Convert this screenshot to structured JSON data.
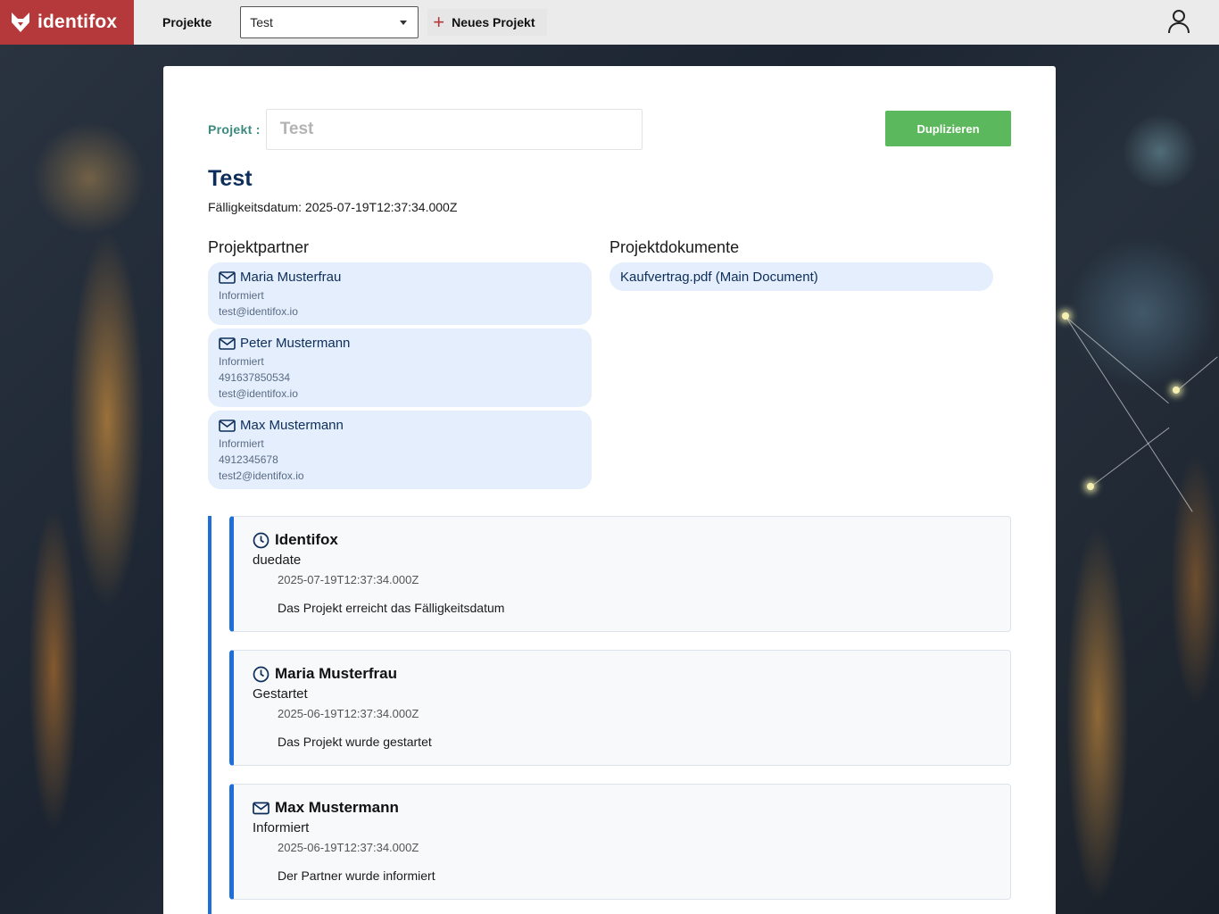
{
  "app": {
    "name": "identifox"
  },
  "topbar": {
    "nav_projects": "Projekte",
    "project_select_value": "Test",
    "new_project_label": "Neues Projekt"
  },
  "project": {
    "label": "Projekt :",
    "input_value": "Test",
    "duplicate_label": "Duplizieren",
    "title": "Test",
    "due_line": "Fälligkeitsdatum: 2025-07-19T12:37:34.000Z"
  },
  "partners": {
    "heading": "Projektpartner",
    "items": [
      {
        "name": "Maria Musterfrau",
        "status": "Informiert",
        "phone": "",
        "email": "test@identifox.io"
      },
      {
        "name": "Peter Mustermann",
        "status": "Informiert",
        "phone": "491637850534",
        "email": "test@identifox.io"
      },
      {
        "name": "Max Mustermann",
        "status": "Informiert",
        "phone": "4912345678",
        "email": "test2@identifox.io"
      }
    ]
  },
  "documents": {
    "heading": "Projektdokumente",
    "items": [
      {
        "name": "Kaufvertrag.pdf (Main Document)"
      }
    ]
  },
  "timeline": [
    {
      "icon": "clock-icon",
      "actor": "Identifox",
      "type": "duedate",
      "date": "2025-07-19T12:37:34.000Z",
      "description": "Das Projekt erreicht das Fälligkeitsdatum"
    },
    {
      "icon": "clock-icon",
      "actor": "Maria Musterfrau",
      "type": "Gestartet",
      "date": "2025-06-19T12:37:34.000Z",
      "description": "Das Projekt wurde gestartet"
    },
    {
      "icon": "mail-icon",
      "actor": "Max Mustermann",
      "type": "Informiert",
      "date": "2025-06-19T12:37:34.000Z",
      "description": "Der Partner wurde informiert"
    }
  ],
  "colors": {
    "brand": "#b5393a",
    "accent_green": "#5cb85c",
    "timeline_blue": "#1e6fd9",
    "title_navy": "#0d2e5a",
    "label_teal": "#3a8a7f"
  }
}
